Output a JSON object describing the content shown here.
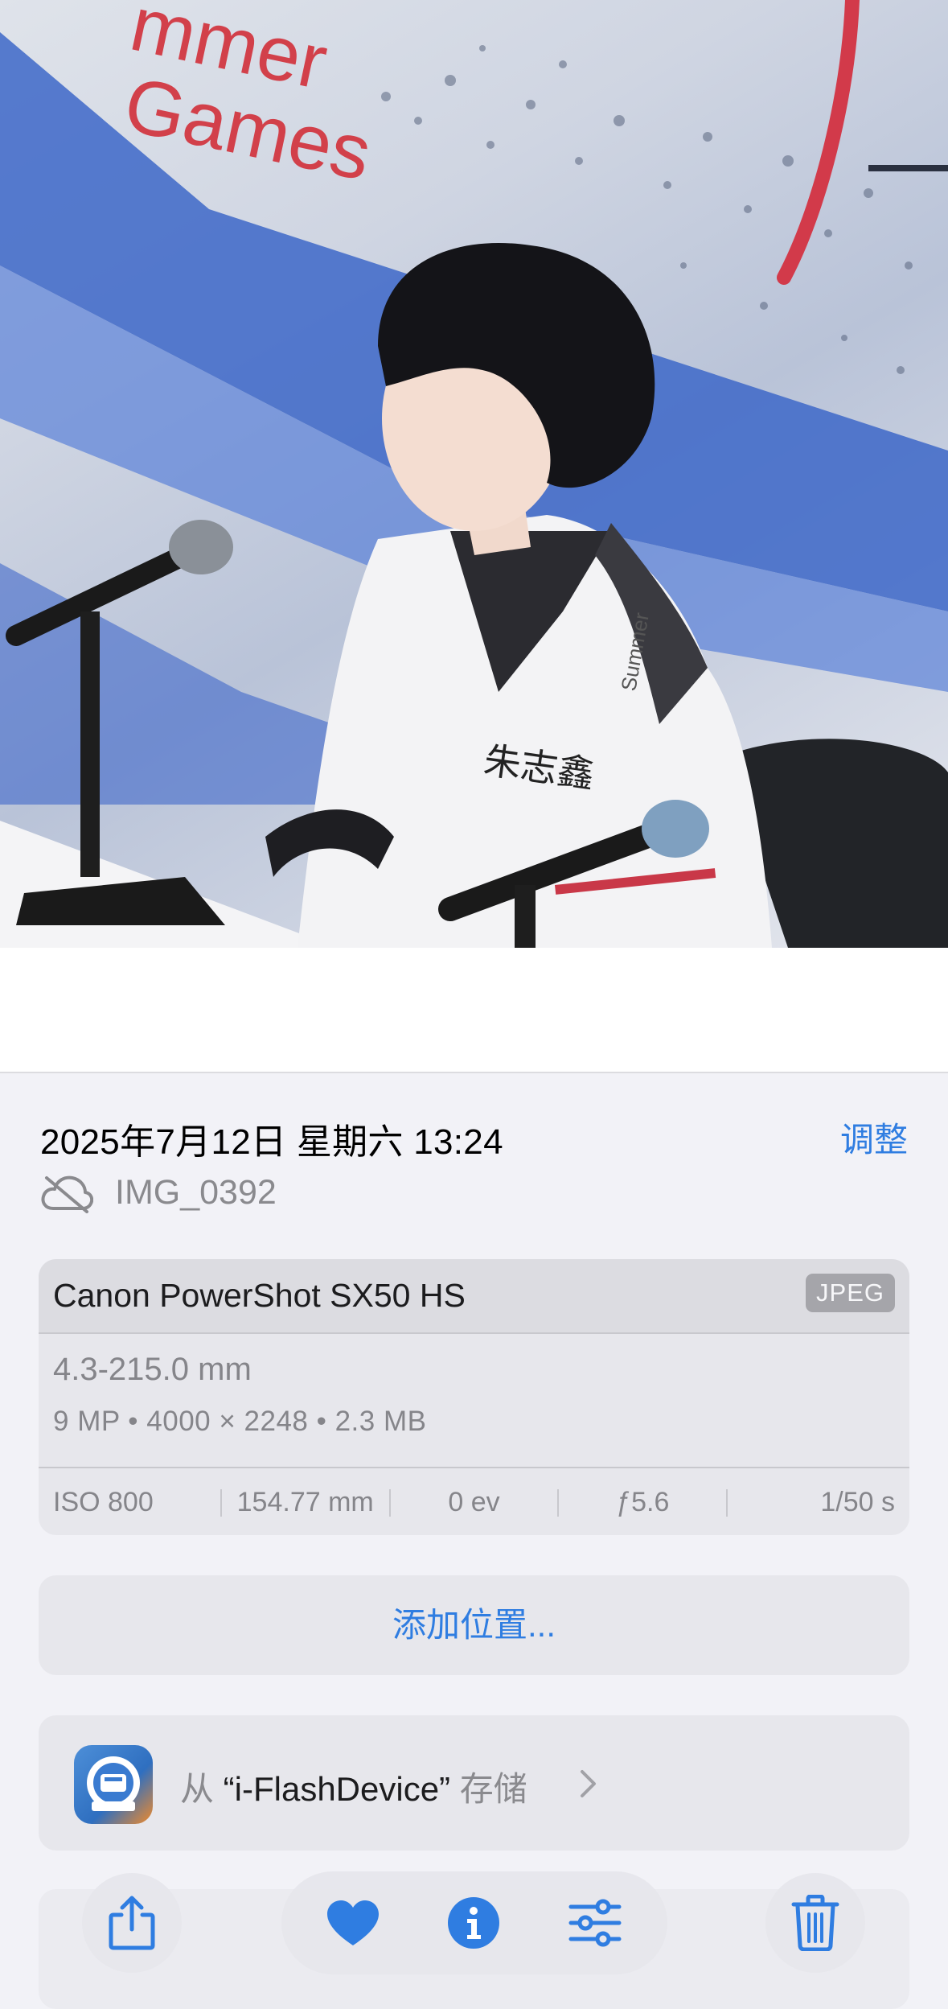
{
  "photo": {
    "banner_lines": [
      "mmer",
      "Games"
    ],
    "jersey_text": "Summer",
    "chest_text": "朱志鑫"
  },
  "info": {
    "datetime": "2025年7月12日 星期六 13:24",
    "adjust_label": "调整",
    "cloud_icon": "cloud-slash-icon",
    "filename": "IMG_0392"
  },
  "metadata": {
    "camera": "Canon PowerShot SX50 HS",
    "format": "JPEG",
    "lens": "4.3-215.0 mm",
    "specs": "9 MP • 4000 × 2248 • 2.3 MB",
    "exif": [
      "ISO 800",
      "154.77 mm",
      "0 ev",
      "ƒ5.6",
      "1/50 s"
    ]
  },
  "location": {
    "label": "添加位置..."
  },
  "saved_from": {
    "prefix": "从 ",
    "app_name": "“i-FlashDevice”",
    "suffix": " 存储",
    "icon": "i-flashdevice-app-icon"
  },
  "toolbar": {
    "icons": [
      "share-icon",
      "heart-icon",
      "info-icon",
      "sliders-icon",
      "trash-icon"
    ],
    "accent": "#2f7de1"
  },
  "colors": {
    "accent": "#2f7de1",
    "secondary_text": "#8a8a8e",
    "background": "#f2f2f7"
  }
}
